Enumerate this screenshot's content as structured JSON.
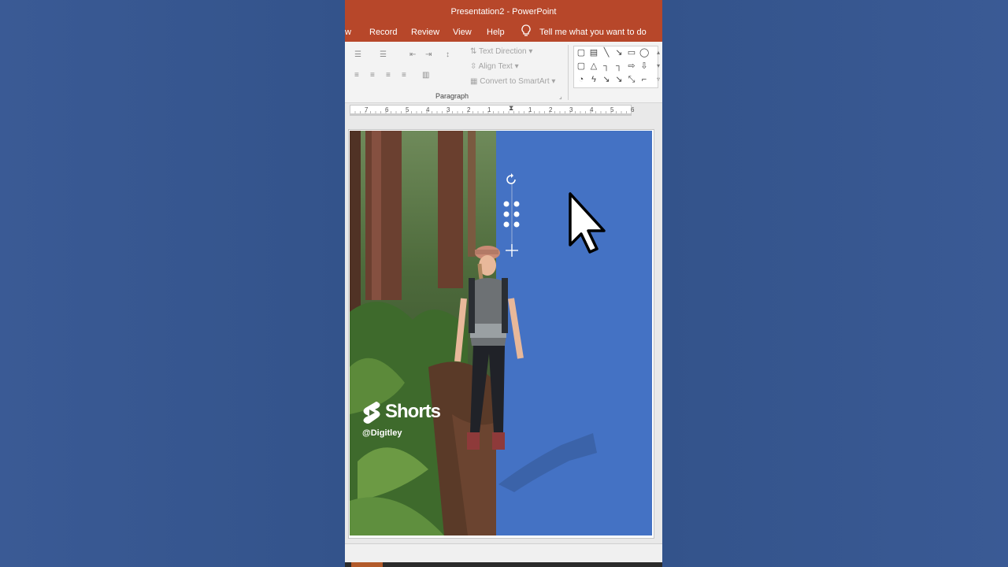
{
  "window": {
    "title": "Presentation2  -  PowerPoint"
  },
  "tabs": [
    {
      "label": "w"
    },
    {
      "label": "Record"
    },
    {
      "label": "Review"
    },
    {
      "label": "View"
    },
    {
      "label": "Help"
    }
  ],
  "tell_me": {
    "label": "Tell me what you want to do"
  },
  "ribbon": {
    "text_direction": "Text Direction",
    "align_text": "Align Text",
    "convert_smartart": "Convert to SmartArt",
    "group_paragraph": "Paragraph"
  },
  "ruler": {
    "ticks": [
      "7",
      "6",
      "5",
      "4",
      "3",
      "2",
      "1",
      "",
      "1",
      "2",
      "3",
      "4",
      "5",
      "6"
    ]
  },
  "overlay": {
    "shorts_label": "Shorts",
    "channel": "@Digitley"
  },
  "colors": {
    "title_bar": "#b7472a",
    "slide_panel": "#4472c4"
  }
}
